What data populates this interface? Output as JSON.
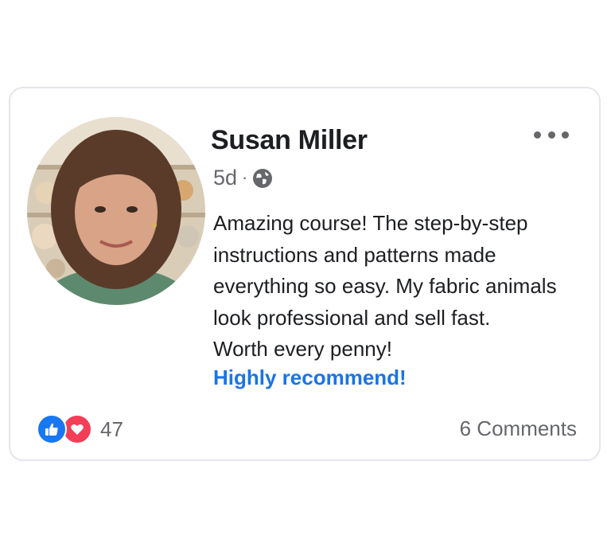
{
  "post": {
    "author": "Susan Miller",
    "time": "5d",
    "separator": "·",
    "privacy_icon": "globe-icon",
    "more_icon": "more-options-icon",
    "avatar_icon": "profile-photo",
    "text_lines": [
      "Amazing course! The step-by-step",
      "instructions and patterns made",
      "everything so easy. My fabric animals",
      "look professional and sell fast.",
      "Worth every penny!"
    ],
    "highlight": "Highly recommend!"
  },
  "footer": {
    "reaction_icons": [
      "like-icon",
      "love-icon"
    ],
    "reaction_count": "47",
    "comments": "6 Comments"
  },
  "colors": {
    "link_blue": "#1b74e4",
    "like_blue": "#1877f2",
    "love_red": "#f33e58",
    "secondary_text": "#65676b",
    "primary_text": "#1c1e21",
    "card_border": "#e4e6eb"
  }
}
